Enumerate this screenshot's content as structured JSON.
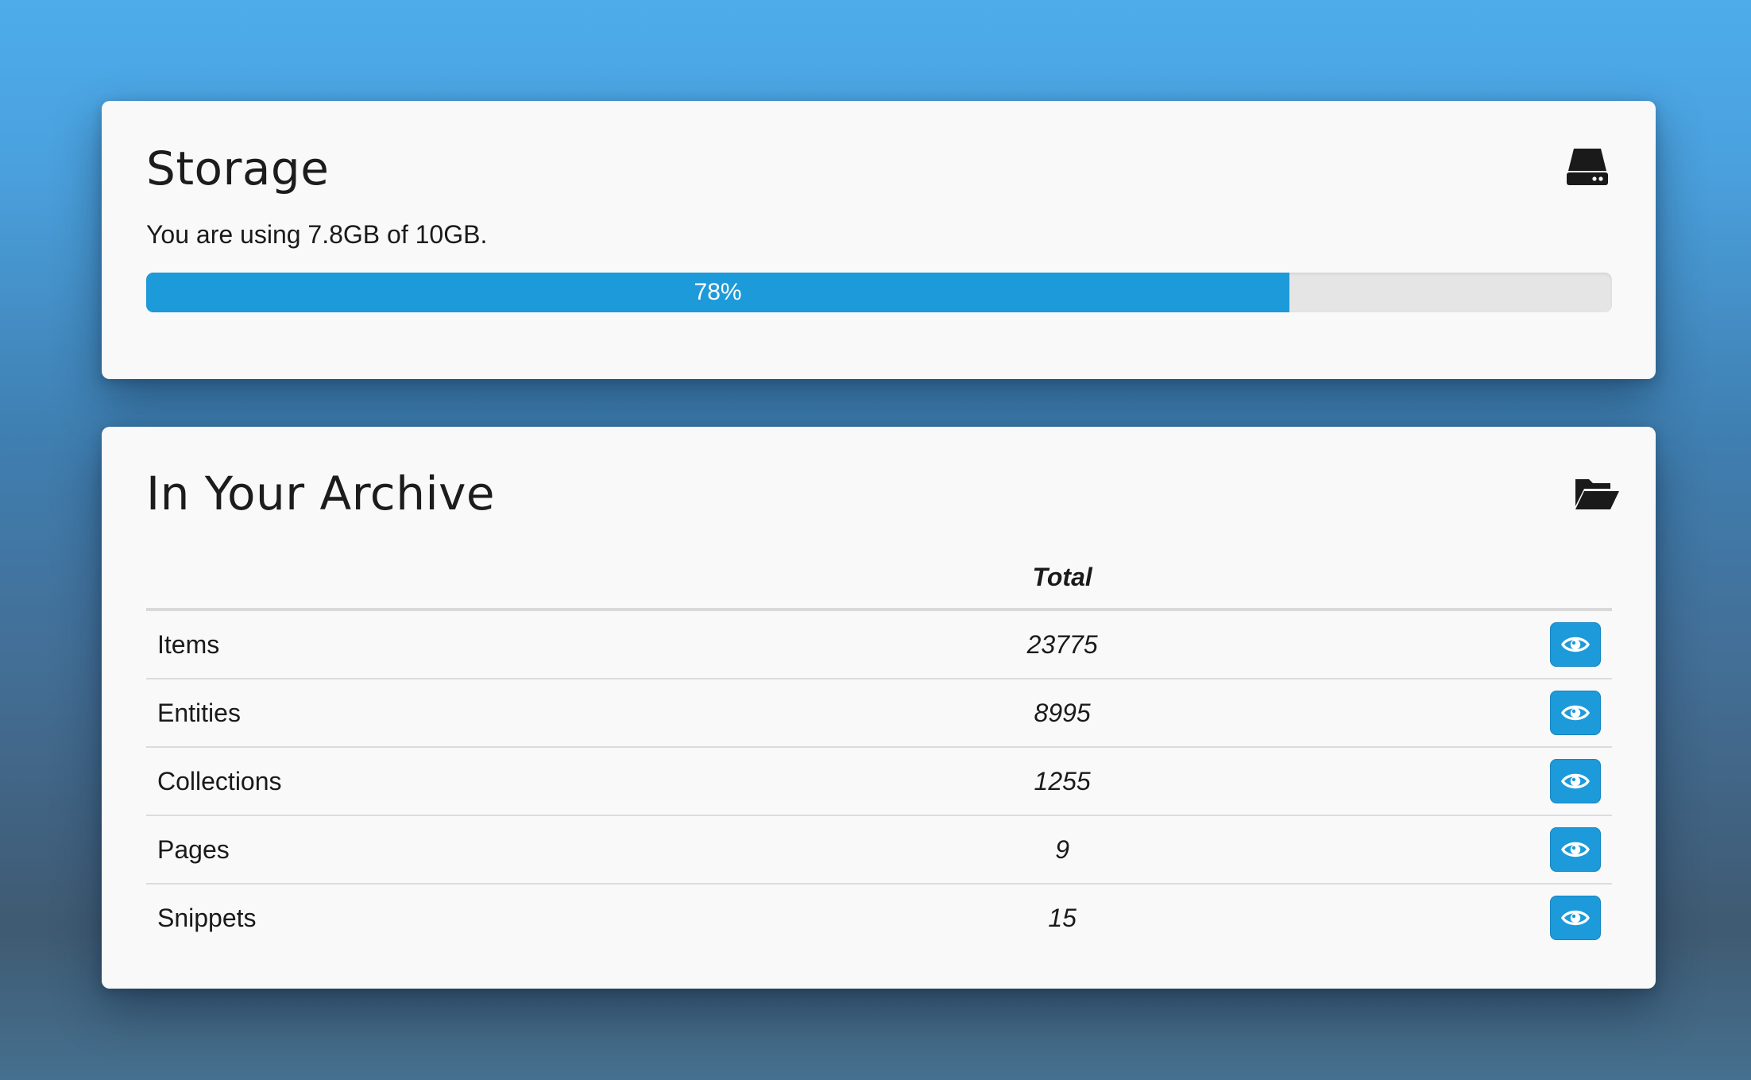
{
  "storage": {
    "title": "Storage",
    "icon": "hard-drive-icon",
    "usage_text": "You are using 7.8GB of 10GB.",
    "progress_percent": 78,
    "progress_label": "78%"
  },
  "archive": {
    "title": "In Your Archive",
    "icon": "folder-open-icon",
    "columns": [
      "",
      "Total",
      ""
    ],
    "rows": [
      {
        "label": "Items",
        "total": "23775",
        "action_icon": "eye-icon"
      },
      {
        "label": "Entities",
        "total": "8995",
        "action_icon": "eye-icon"
      },
      {
        "label": "Collections",
        "total": "1255",
        "action_icon": "eye-icon"
      },
      {
        "label": "Pages",
        "total": "9",
        "action_icon": "eye-icon"
      },
      {
        "label": "Snippets",
        "total": "15",
        "action_icon": "eye-icon"
      }
    ]
  },
  "colors": {
    "accent": "#1d9ad9",
    "card_background": "#f9f9f9",
    "progress_track": "#e5e5e5"
  }
}
